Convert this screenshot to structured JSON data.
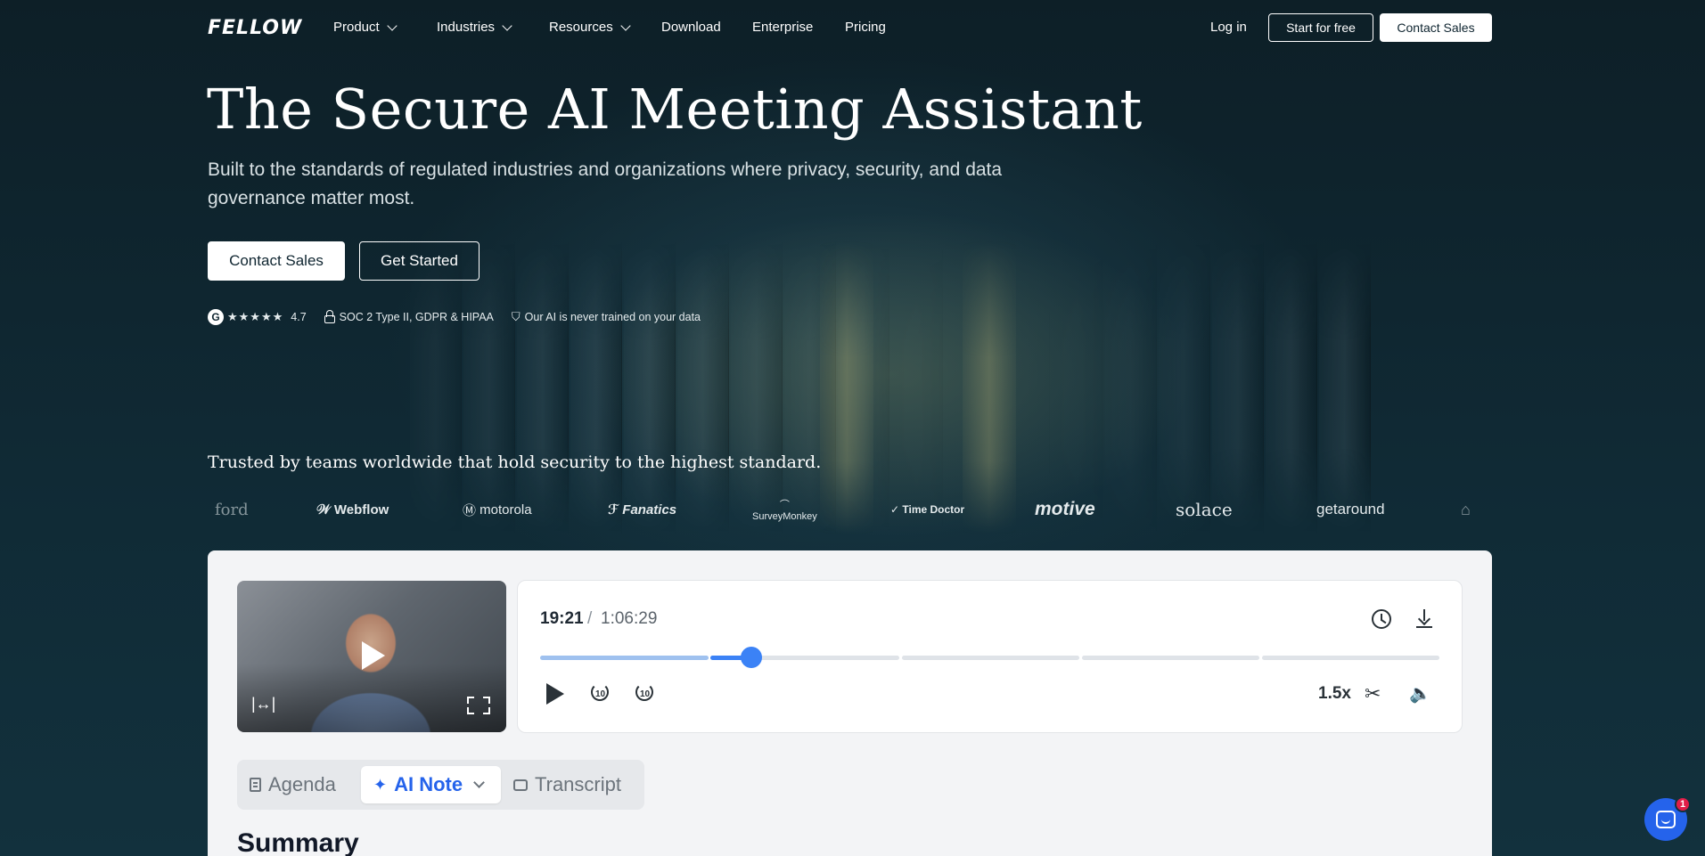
{
  "brand": {
    "logo_text": "FELLOW"
  },
  "nav": {
    "items": [
      {
        "label": "Product",
        "has_dropdown": true
      },
      {
        "label": "Industries",
        "has_dropdown": true
      },
      {
        "label": "Resources",
        "has_dropdown": true
      },
      {
        "label": "Download",
        "has_dropdown": false
      },
      {
        "label": "Enterprise",
        "has_dropdown": false
      },
      {
        "label": "Pricing",
        "has_dropdown": false
      }
    ],
    "login_label": "Log in",
    "start_free_label": "Start for free",
    "contact_sales_label": "Contact Sales"
  },
  "hero": {
    "title": "The Secure AI Meeting Assistant",
    "subtitle": "Built to the standards of regulated industries and organizations where privacy, security, and data governance matter most.",
    "primary_cta": "Contact Sales",
    "secondary_cta": "Get Started",
    "rating": {
      "icon": "g2-icon",
      "stars": "★★★★★",
      "value": "4.7"
    },
    "compliance_text": "SOC 2 Type II, GDPR & HIPAA",
    "ai_training_text": "Our AI is never trained on your data"
  },
  "trusted": {
    "heading": "Trusted by teams worldwide that hold security to the highest standard.",
    "logos": [
      "ford",
      "Webflow",
      "motorola",
      "Fanatics",
      "SurveyMonkey",
      "Time Doctor",
      "motive",
      "solace",
      "getaround"
    ]
  },
  "player": {
    "current_time": "19:21",
    "separator": "/",
    "total_time": "1:06:29",
    "progress": 0.245,
    "speed": "1.5x",
    "skip_back": "10",
    "skip_forward": "10"
  },
  "notes_tabs": {
    "items": [
      {
        "label": "Agenda",
        "active": false
      },
      {
        "label": "AI Note",
        "active": true
      },
      {
        "label": "Transcript",
        "active": false
      }
    ]
  },
  "summary_heading": "Summary",
  "chat_widget": {
    "badge_count": "1"
  },
  "colors": {
    "bg": "#0f2530",
    "accent": "#2563eb",
    "card": "#f3f4f6"
  }
}
